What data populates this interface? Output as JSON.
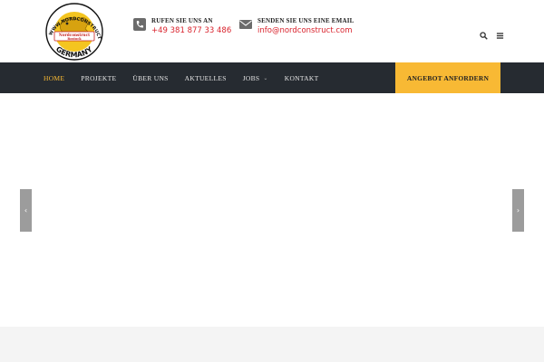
{
  "logo": {
    "top_text": "WWW.NORDCONSTRUCT.COM",
    "banner_text": "Nordconstruct Rostock",
    "bottom_text": "GERMANY"
  },
  "header": {
    "phone": {
      "label": "RUFEN SIE UNS AN",
      "value": "+49 381 877 33 486",
      "icon": "phone-icon"
    },
    "email": {
      "label": "SENDEN SIE UNS EINE EMAIL",
      "value": "info@nordconstruct.com",
      "icon": "envelope-icon"
    },
    "icons": [
      "search-icon",
      "menu-icon"
    ]
  },
  "nav": {
    "items": [
      {
        "label": "HOME",
        "active": true
      },
      {
        "label": "PROJEKTE"
      },
      {
        "label": "ÜBER UNS"
      },
      {
        "label": "AKTUELLES"
      },
      {
        "label": "JOBS",
        "caret": "⌄"
      },
      {
        "label": "KONTAKT"
      }
    ],
    "cta": "ANGEBOT ANFORDERN"
  },
  "slider": {
    "prev": "‹",
    "next": "›"
  },
  "colors": {
    "nav_bg": "#262b31",
    "accent": "#f8b934",
    "link_red": "#d9232d"
  }
}
